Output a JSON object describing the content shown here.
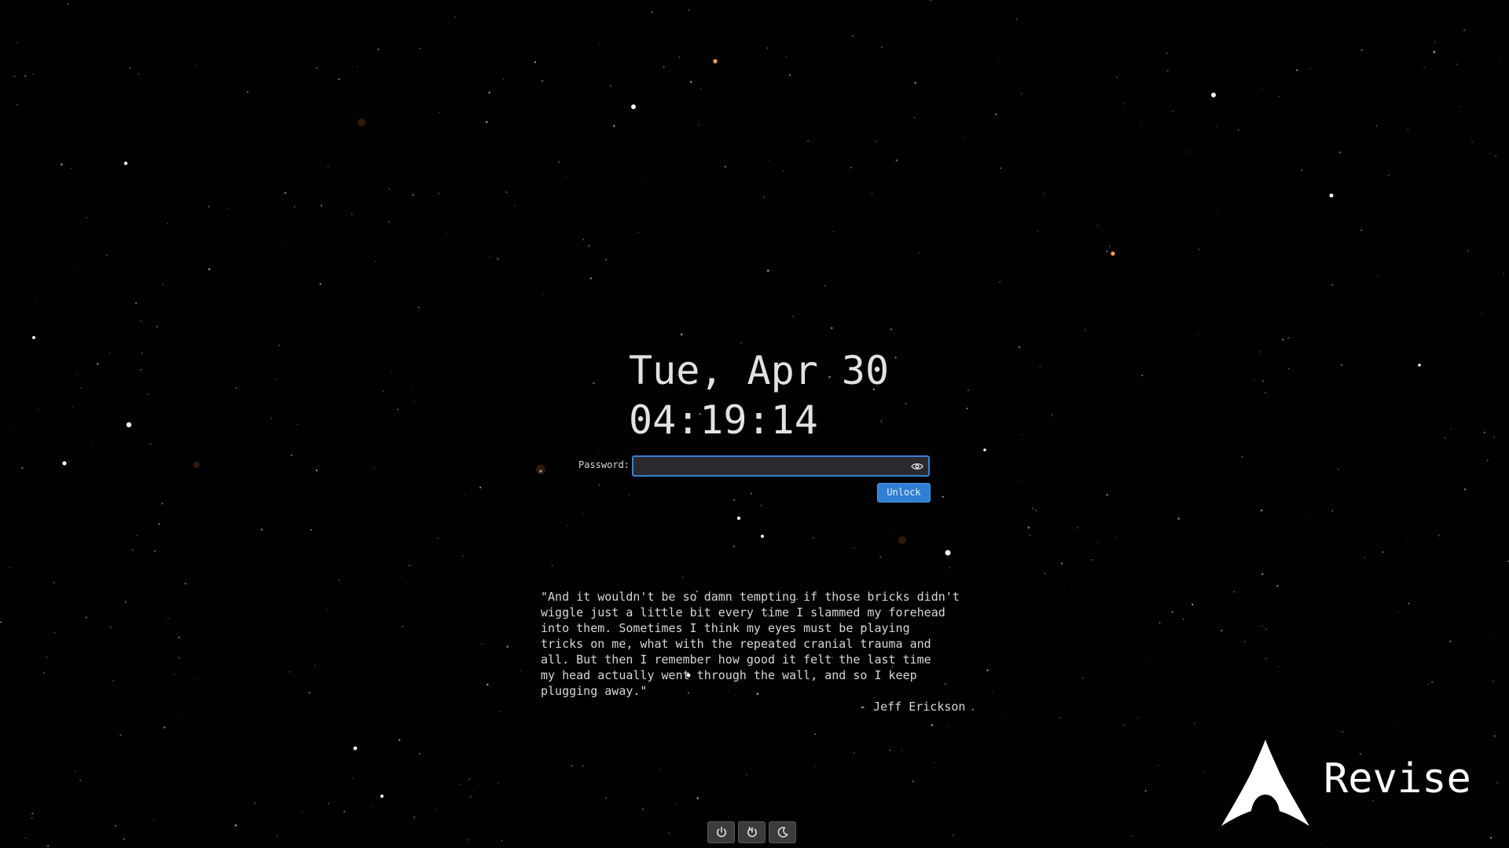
{
  "lock_screen": {
    "date": "Tue, Apr 30",
    "time": "04:19:14"
  },
  "login": {
    "password_label": "Password:",
    "password_value": "",
    "reveal_icon": "eye-icon",
    "unlock_label": "Unlock",
    "accent_color": "#2f7fd4"
  },
  "quote": {
    "lines": [
      "\"And it wouldn't be so damn tempting if those bricks didn't",
      "wiggle just a little bit every time I slammed my forehead",
      "into them. Sometimes I think my eyes must be playing",
      "tricks on me, what with the repeated cranial trauma and",
      "all. But then I remember how good it felt the last time",
      "my head actually went through the wall, and so I keep",
      "plugging away.\""
    ],
    "author": "- Jeff Erickson"
  },
  "branding": {
    "logo_icon": "arch-logo-icon",
    "name": "Revise"
  },
  "power_actions": [
    {
      "icon": "power-icon",
      "action": "shutdown"
    },
    {
      "icon": "restart-icon",
      "action": "restart"
    },
    {
      "icon": "moon-icon",
      "action": "suspend"
    }
  ]
}
